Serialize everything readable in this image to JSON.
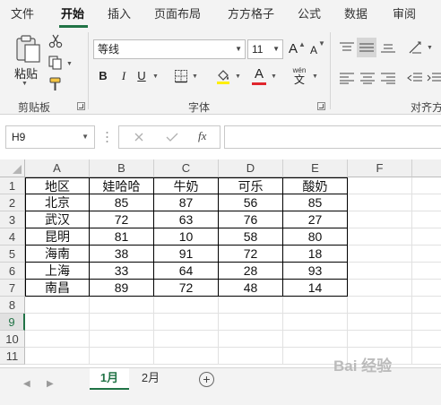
{
  "menu": {
    "tabs": [
      "文件",
      "开始",
      "插入",
      "页面布局",
      "方方格子",
      "公式",
      "数据",
      "审阅"
    ],
    "active": "开始"
  },
  "ribbon": {
    "clipboard": {
      "paste_label": "粘贴",
      "group_label": "剪贴板"
    },
    "font": {
      "font_name": "等线",
      "font_size": "11",
      "bold": "B",
      "italic": "I",
      "underline": "U",
      "grow_font": "A",
      "shrink_font": "A",
      "font_color": "A",
      "phonetic_top": "wén",
      "phonetic_bottom": "文",
      "group_label": "字体"
    },
    "alignment": {
      "group_label": "对齐方"
    }
  },
  "formula_bar": {
    "name_box": "H9",
    "fx_label": "fx",
    "value": ""
  },
  "sheet": {
    "column_headers": [
      "A",
      "B",
      "C",
      "D",
      "E",
      "F"
    ],
    "row_headers": [
      "1",
      "2",
      "3",
      "4",
      "5",
      "6",
      "7",
      "8",
      "9",
      "10",
      "11"
    ],
    "selected_row": "9",
    "rows": [
      [
        "地区",
        "娃哈哈",
        "牛奶",
        "可乐",
        "酸奶"
      ],
      [
        "北京",
        "85",
        "87",
        "56",
        "85"
      ],
      [
        "武汉",
        "72",
        "63",
        "76",
        "27"
      ],
      [
        "昆明",
        "81",
        "10",
        "58",
        "80"
      ],
      [
        "海南",
        "38",
        "91",
        "72",
        "18"
      ],
      [
        "上海",
        "33",
        "64",
        "28",
        "93"
      ],
      [
        "南昌",
        "89",
        "72",
        "48",
        "14"
      ]
    ]
  },
  "sheet_tabs": {
    "tabs": [
      "1月",
      "2月"
    ],
    "active": "1月",
    "add_label": "+"
  },
  "watermark": "Bai 经验",
  "colors": {
    "accent": "#217346",
    "font_color_underline": "#e0262d",
    "highlight": "#ffef00"
  }
}
